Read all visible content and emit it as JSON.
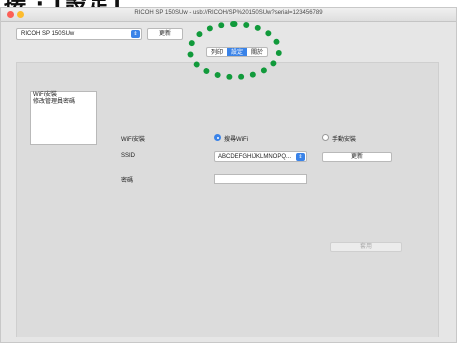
{
  "page_heading": "接 · [設定]",
  "window": {
    "title": "RICOH SP 150SUw - usb://RICOH/SP%20150SUw?serial=123456789"
  },
  "toolbar": {
    "printer_select_value": "RICOH SP 150SUw",
    "refresh_label": "更新"
  },
  "tabs": [
    {
      "label": "列印",
      "active": false
    },
    {
      "label": "設定",
      "active": true
    },
    {
      "label": "關於",
      "active": false
    }
  ],
  "sidebar": {
    "items": [
      {
        "label": "WiFi安裝"
      },
      {
        "label": "修改管理員密碼"
      }
    ]
  },
  "wifi_form": {
    "install_label": "WiFi安裝",
    "search_option": "搜尋WiFi",
    "manual_option": "手動安裝",
    "selected_option": "搜尋WiFi",
    "ssid_label": "SSID",
    "ssid_value": "ABCDEFGHIJKLMNOPQ...",
    "ssid_refresh_label": "更新",
    "password_label": "密碼",
    "password_value": "",
    "apply_label": "套用"
  },
  "colors": {
    "accent": "#3a83e8",
    "highlight_ring": "#119a3b"
  }
}
